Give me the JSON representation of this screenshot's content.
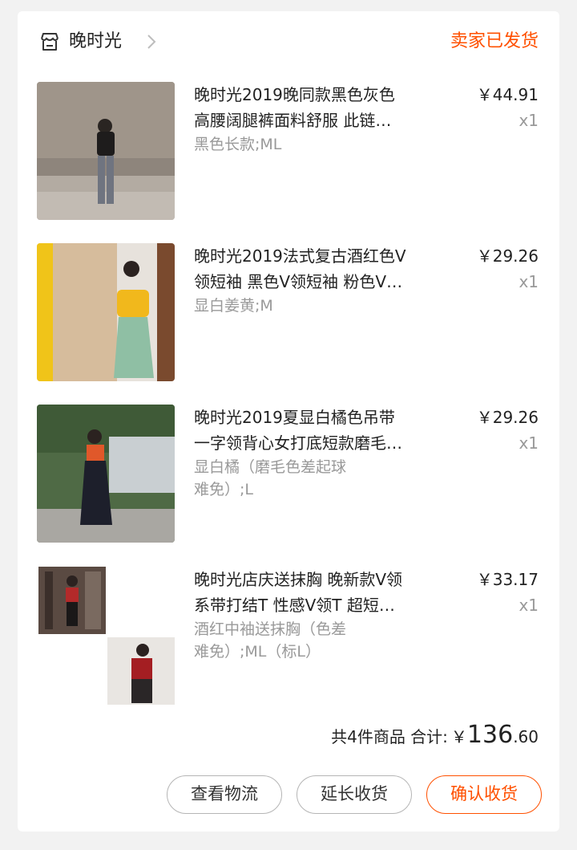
{
  "shop": {
    "name": "晚时光",
    "status": "卖家已发货"
  },
  "items": [
    {
      "title_line1": "晚时光2019晚同款黑色灰色",
      "title_line2": "高腰阔腿裤面料舒服 此链…",
      "sku": "黑色长款;ML",
      "price": "￥44.91",
      "qty": "x1"
    },
    {
      "title_line1": "晚时光2019法式复古酒红色V",
      "title_line2": "领短袖 黑色V领短袖 粉色V…",
      "sku": "显白姜黄;M",
      "price": "￥29.26",
      "qty": "x1"
    },
    {
      "title_line1": "晚时光2019夏显白橘色吊带",
      "title_line2": "一字领背心女打底短款磨毛…",
      "sku_line1": "显白橘（磨毛色差起球",
      "sku_line2": "难免）;L",
      "price": "￥29.26",
      "qty": "x1"
    },
    {
      "title_line1": "晚时光店庆送抹胸 晚新款V领",
      "title_line2": "系带打结T 性感V领T 超短…",
      "sku_line1": "酒红中袖送抹胸（色差",
      "sku_line2": "难免）;ML（标L）",
      "price": "￥33.17",
      "qty": "x1"
    }
  ],
  "summary": {
    "count_text": "共4件商品 合计:",
    "currency": "￥",
    "total_int": "136",
    "total_dec": ".60"
  },
  "actions": {
    "logistics": "查看物流",
    "extend": "延长收货",
    "confirm": "确认收货"
  },
  "colors": {
    "accent": "#ff5000",
    "muted": "#999999",
    "background": "#f2f2f2"
  }
}
